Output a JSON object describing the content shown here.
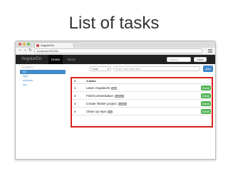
{
  "slide": {
    "title": "List of tasks"
  },
  "browser": {
    "tab_title": "AngularDo",
    "address": "localhost:9000/#/"
  },
  "navbar": {
    "brand": "AngularDo",
    "links": [
      {
        "label": "Home",
        "active": true
      },
      {
        "label": "About",
        "active": false
      }
    ],
    "search_placeholder": "Search",
    "clear_label": "Clear"
  },
  "sidebar": {
    "header": "PRIORITY",
    "items": [
      {
        "label": "All",
        "active": true
      },
      {
        "label": "high",
        "active": false
      },
      {
        "label": "medium",
        "active": false
      },
      {
        "label": "low",
        "active": false
      }
    ]
  },
  "add_task": {
    "priority_value": "Low",
    "input_placeholder": "Enter new task here",
    "add_label": "Add"
  },
  "tasks": {
    "header_num": "#",
    "header_count": "4 tasks",
    "done_label": "Done",
    "rows": [
      {
        "num": "1",
        "text": "Learn AngularJS",
        "badge": "high"
      },
      {
        "num": "2",
        "text": "Finish presentation",
        "badge": "medium"
      },
      {
        "num": "3",
        "text": "Create Tasker project",
        "badge": "medium"
      },
      {
        "num": "4",
        "text": "Clean up repo",
        "badge": "low"
      }
    ]
  },
  "colors": {
    "navbar_bg": "#222222",
    "primary": "#428bca",
    "success": "#5cb85c",
    "highlight_border": "#d9231f"
  }
}
